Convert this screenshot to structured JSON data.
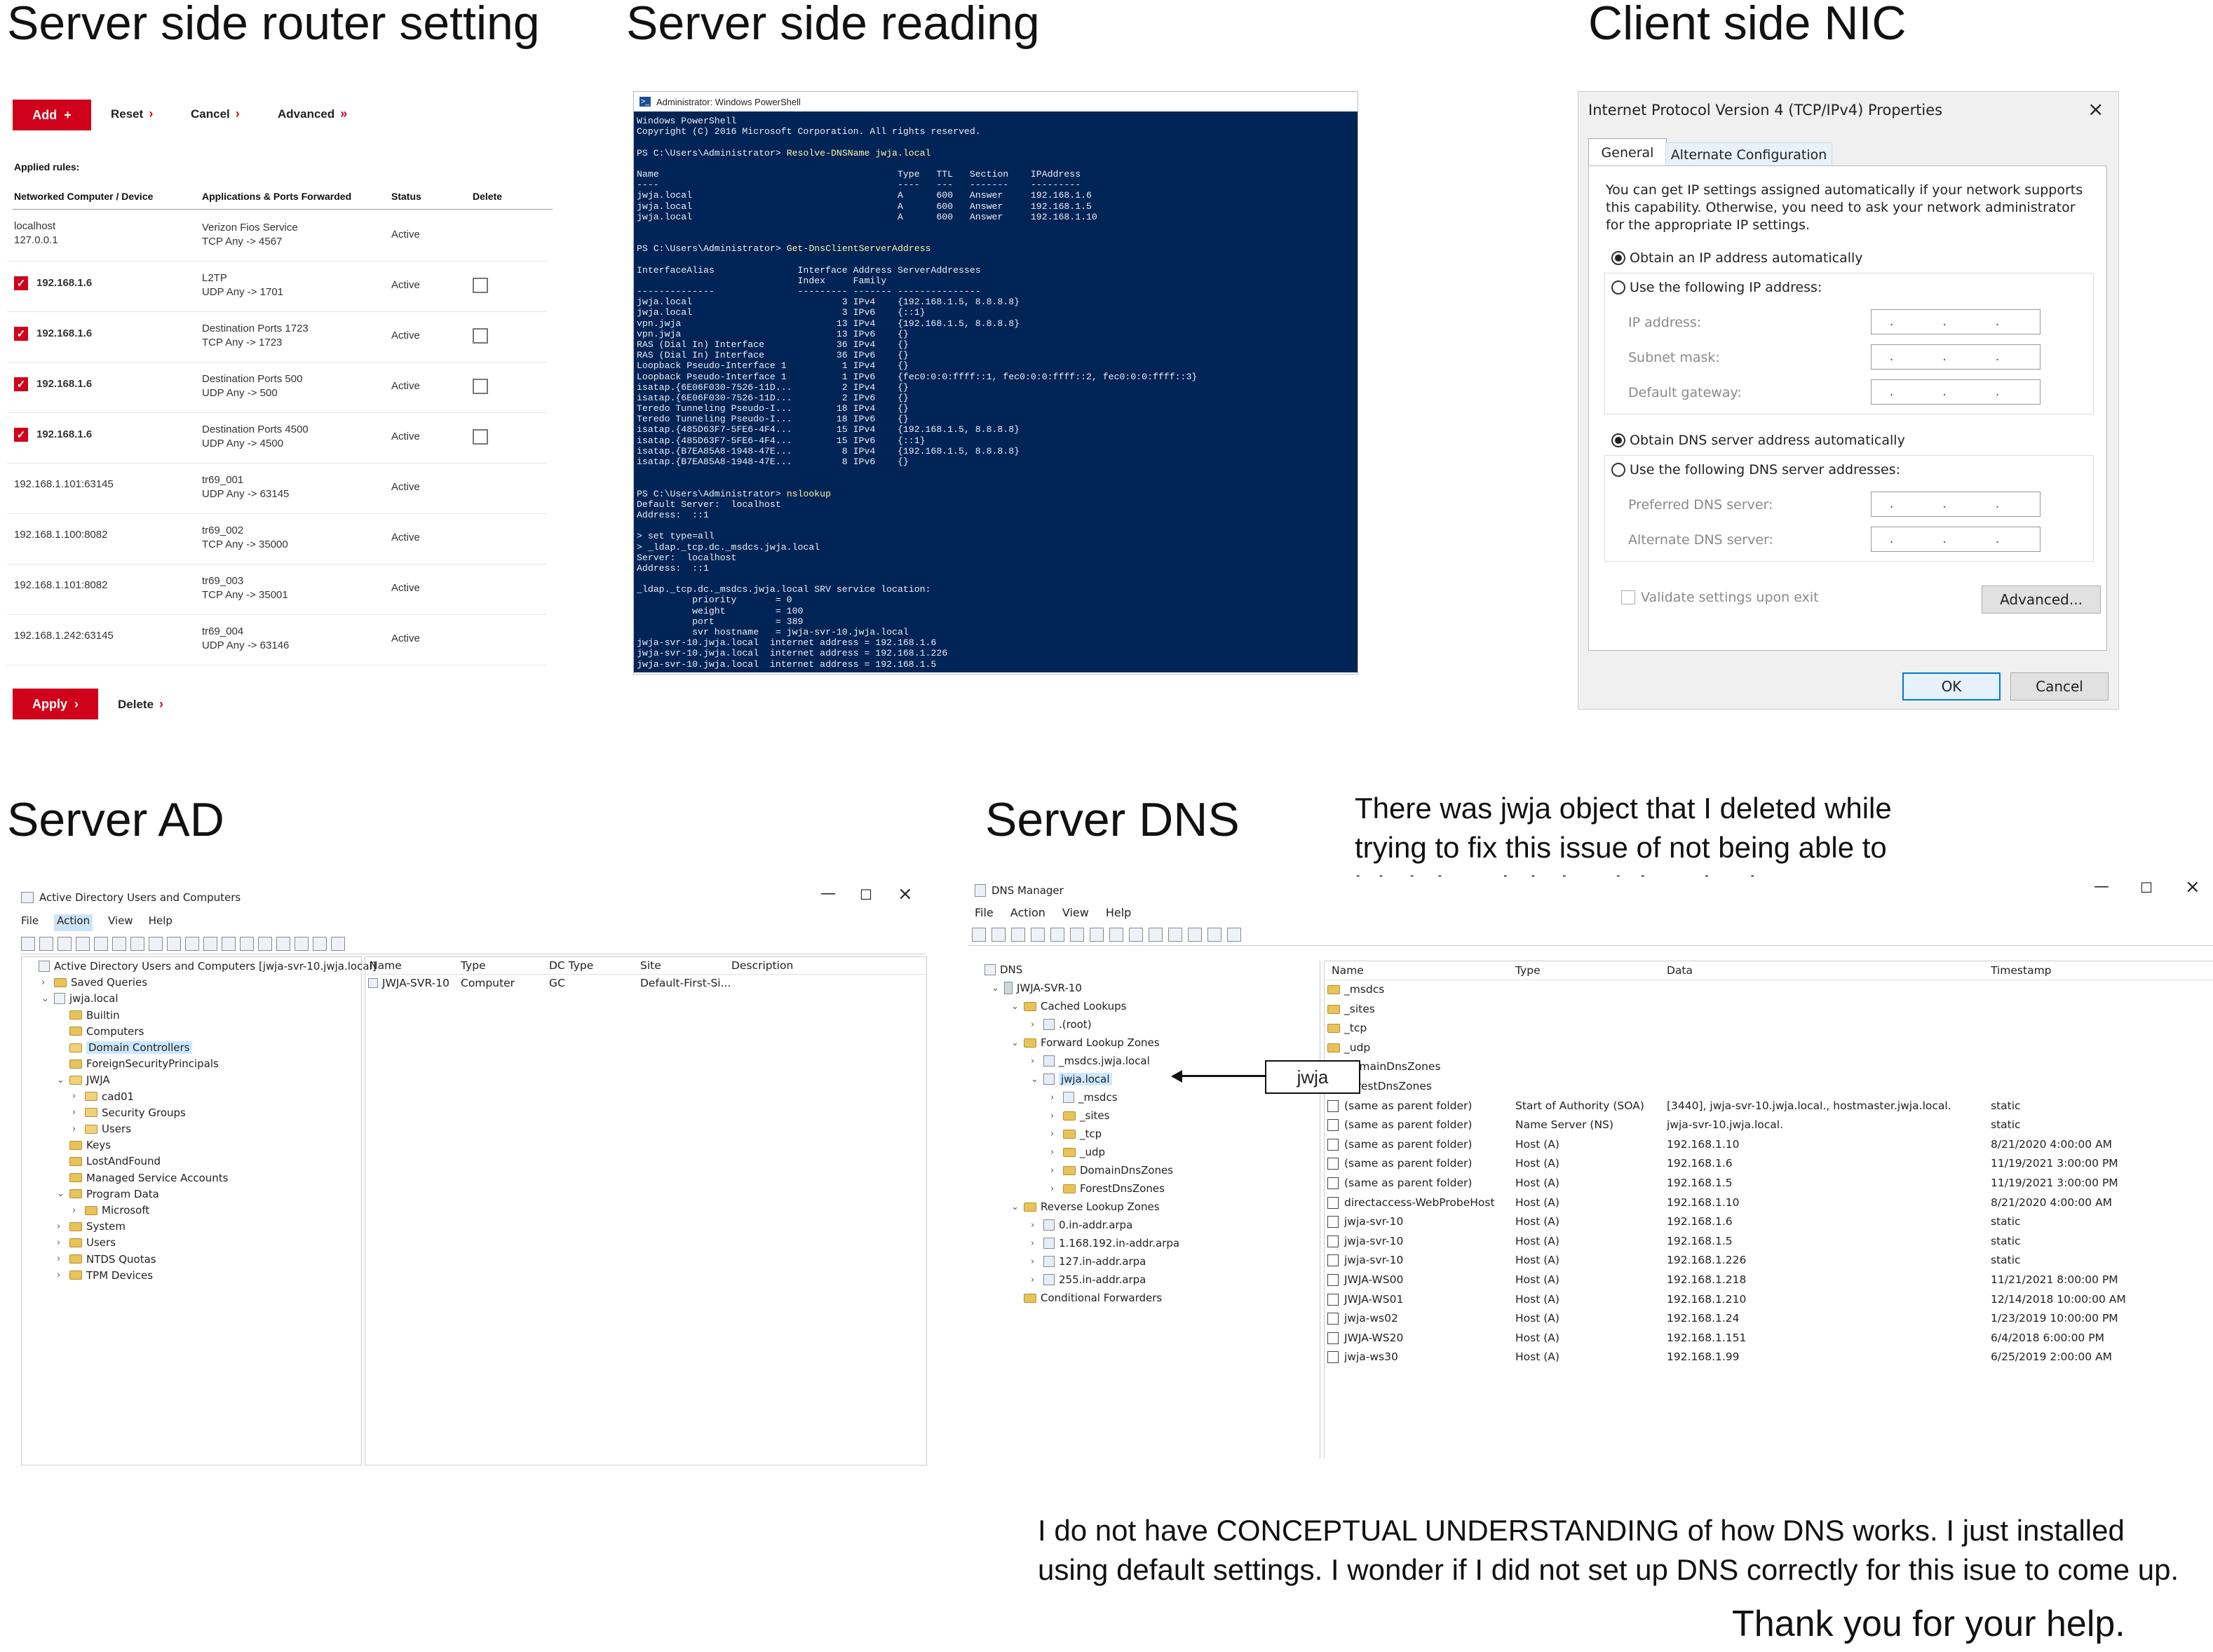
{
  "headings": {
    "router": "Server side router setting",
    "reading": "Server side reading",
    "nic": "Client side NIC",
    "ad": "Server AD",
    "dns": "Server DNS"
  },
  "notes": {
    "deleted": "There was jwja object that I deleted while trying to fix this issue of not being able to join jwja or jwja.local domain via VPN.",
    "conceptual": "I do not have CONCEPTUAL UNDERSTANDING of how DNS works. I just installed using default settings. I wonder if I did not set up DNS correctly for this isue to come up.",
    "thanks": "Thank you for your help."
  },
  "router": {
    "add_label": "Add",
    "reset_label": "Reset",
    "cancel_label": "Cancel",
    "advanced_label": "Advanced",
    "applied_rules": "Applied rules:",
    "columns": [
      "Networked Computer / Device",
      "Applications & Ports Forwarded",
      "Status",
      "Delete"
    ],
    "rows": [
      {
        "device": "localhost",
        "device2": "127.0.0.1",
        "app": "Verizon Fios Service",
        "ports": "TCP Any -> 4567",
        "status": "Active",
        "checked": false,
        "has_delete": false
      },
      {
        "device": "192.168.1.6",
        "device2": "",
        "app": "L2TP",
        "ports": "UDP Any -> 1701",
        "status": "Active",
        "checked": true,
        "has_delete": true
      },
      {
        "device": "192.168.1.6",
        "device2": "",
        "app": "Destination Ports 1723",
        "ports": "TCP Any -> 1723",
        "status": "Active",
        "checked": true,
        "has_delete": true
      },
      {
        "device": "192.168.1.6",
        "device2": "",
        "app": "Destination Ports 500",
        "ports": "UDP Any -> 500",
        "status": "Active",
        "checked": true,
        "has_delete": true
      },
      {
        "device": "192.168.1.6",
        "device2": "",
        "app": "Destination Ports 4500",
        "ports": "UDP Any -> 4500",
        "status": "Active",
        "checked": true,
        "has_delete": true
      },
      {
        "device": "192.168.1.101:63145",
        "device2": "",
        "app": "tr69_001",
        "ports": "UDP Any -> 63145",
        "status": "Active",
        "checked": false,
        "has_delete": false
      },
      {
        "device": "192.168.1.100:8082",
        "device2": "",
        "app": "tr69_002",
        "ports": "TCP Any -> 35000",
        "status": "Active",
        "checked": false,
        "has_delete": false
      },
      {
        "device": "192.168.1.101:8082",
        "device2": "",
        "app": "tr69_003",
        "ports": "TCP Any -> 35001",
        "status": "Active",
        "checked": false,
        "has_delete": false
      },
      {
        "device": "192.168.1.242:63145",
        "device2": "",
        "app": "tr69_004",
        "ports": "UDP Any -> 63146",
        "status": "Active",
        "checked": false,
        "has_delete": false
      }
    ],
    "apply_label": "Apply",
    "delete_label": "Delete"
  },
  "powershell": {
    "title": "Administrator: Windows PowerShell",
    "lines": [
      {
        "t": "Windows PowerShell",
        "c": ""
      },
      {
        "t": "Copyright (C) 2016 Microsoft Corporation. All rights reserved.",
        "c": ""
      },
      {
        "t": "",
        "c": ""
      },
      {
        "t": "PS C:\\Users\\Administrator> ",
        "c": "Resolve-DNSName jwja.local"
      },
      {
        "t": "",
        "c": ""
      },
      {
        "t": "Name                                           Type   TTL   Section    IPAddress",
        "c": ""
      },
      {
        "t": "----                                           ----   ---   -------    ---------",
        "c": ""
      },
      {
        "t": "jwja.local                                     A      600   Answer     192.168.1.6",
        "c": ""
      },
      {
        "t": "jwja.local                                     A      600   Answer     192.168.1.5",
        "c": ""
      },
      {
        "t": "jwja.local                                     A      600   Answer     192.168.1.10",
        "c": ""
      },
      {
        "t": "",
        "c": ""
      },
      {
        "t": "",
        "c": ""
      },
      {
        "t": "PS C:\\Users\\Administrator> ",
        "c": "Get-DnsClientServerAddress"
      },
      {
        "t": "",
        "c": ""
      },
      {
        "t": "InterfaceAlias               Interface Address ServerAddresses",
        "c": ""
      },
      {
        "t": "                             Index     Family",
        "c": ""
      },
      {
        "t": "--------------               --------- ------- ---------------",
        "c": ""
      },
      {
        "t": "jwja.local                           3 IPv4    {192.168.1.5, 8.8.8.8}",
        "c": ""
      },
      {
        "t": "jwja.local                           3 IPv6    {::1}",
        "c": ""
      },
      {
        "t": "vpn.jwja                            13 IPv4    {192.168.1.5, 8.8.8.8}",
        "c": ""
      },
      {
        "t": "vpn.jwja                            13 IPv6    {}",
        "c": ""
      },
      {
        "t": "RAS (Dial In) Interface             36 IPv4    {}",
        "c": ""
      },
      {
        "t": "RAS (Dial In) Interface             36 IPv6    {}",
        "c": ""
      },
      {
        "t": "Loopback Pseudo-Interface 1          1 IPv4    {}",
        "c": ""
      },
      {
        "t": "Loopback Pseudo-Interface 1          1 IPv6    {fec0:0:0:ffff::1, fec0:0:0:ffff::2, fec0:0:0:ffff::3}",
        "c": ""
      },
      {
        "t": "isatap.{6E06F030-7526-11D...         2 IPv4    {}",
        "c": ""
      },
      {
        "t": "isatap.{6E06F030-7526-11D...         2 IPv6    {}",
        "c": ""
      },
      {
        "t": "Teredo Tunneling Pseudo-I...        18 IPv4    {}",
        "c": ""
      },
      {
        "t": "Teredo Tunneling Pseudo-I...        18 IPv6    {}",
        "c": ""
      },
      {
        "t": "isatap.{485D63F7-5FE6-4F4...        15 IPv4    {192.168.1.5, 8.8.8.8}",
        "c": ""
      },
      {
        "t": "isatap.{485D63F7-5FE6-4F4...        15 IPv6    {::1}",
        "c": ""
      },
      {
        "t": "isatap.{B7EA85A8-1948-47E...         8 IPv4    {192.168.1.5, 8.8.8.8}",
        "c": ""
      },
      {
        "t": "isatap.{B7EA85A8-1948-47E...         8 IPv6    {}",
        "c": ""
      },
      {
        "t": "",
        "c": ""
      },
      {
        "t": "",
        "c": ""
      },
      {
        "t": "PS C:\\Users\\Administrator> ",
        "c": "nslookup"
      },
      {
        "t": "Default Server:  localhost",
        "c": ""
      },
      {
        "t": "Address:  ::1",
        "c": ""
      },
      {
        "t": "",
        "c": ""
      },
      {
        "t": "> set type=all",
        "c": ""
      },
      {
        "t": "> _ldap._tcp.dc._msdcs.jwja.local",
        "c": ""
      },
      {
        "t": "Server:  localhost",
        "c": ""
      },
      {
        "t": "Address:  ::1",
        "c": ""
      },
      {
        "t": "",
        "c": ""
      },
      {
        "t": "_ldap._tcp.dc._msdcs.jwja.local SRV service location:",
        "c": ""
      },
      {
        "t": "          priority       = 0",
        "c": ""
      },
      {
        "t": "          weight         = 100",
        "c": ""
      },
      {
        "t": "          port           = 389",
        "c": ""
      },
      {
        "t": "          svr hostname   = jwja-svr-10.jwja.local",
        "c": ""
      },
      {
        "t": "jwja-svr-10.jwja.local  internet address = 192.168.1.6",
        "c": ""
      },
      {
        "t": "jwja-svr-10.jwja.local  internet address = 192.168.1.226",
        "c": ""
      },
      {
        "t": "jwja-svr-10.jwja.local  internet address = 192.168.1.5",
        "c": ""
      },
      {
        "t": "> _",
        "c": ""
      }
    ]
  },
  "nic": {
    "title": "Internet Protocol Version 4 (TCP/IPv4) Properties",
    "tabs": [
      "General",
      "Alternate Configuration"
    ],
    "description": "You can get IP settings assigned automatically if your network supports this capability. Otherwise, you need to ask your network administrator for the appropriate IP settings.",
    "obtain_ip": "Obtain an IP address automatically",
    "use_ip": "Use the following IP address:",
    "ip_label": "IP address:",
    "mask_label": "Subnet mask:",
    "gateway_label": "Default gateway:",
    "obtain_dns": "Obtain DNS server address automatically",
    "use_dns": "Use the following DNS server addresses:",
    "pref_dns": "Preferred DNS server:",
    "alt_dns": "Alternate DNS server:",
    "ip_placeholder": ". . .",
    "validate": "Validate settings upon exit",
    "advanced": "Advanced...",
    "ok": "OK",
    "cancel": "Cancel"
  },
  "ad": {
    "title": "Active Directory Users and Computers",
    "menu": [
      "File",
      "Action",
      "View",
      "Help"
    ],
    "tree": [
      {
        "label": "Active Directory Users and Computers [jwja-svr-10.jwja.local]",
        "indent": 0,
        "icon": "console",
        "arrow": ""
      },
      {
        "label": "Saved Queries",
        "indent": 1,
        "icon": "folder",
        "arrow": ">"
      },
      {
        "label": "jwja.local",
        "indent": 1,
        "icon": "domain",
        "arrow": "v"
      },
      {
        "label": "Builtin",
        "indent": 2,
        "icon": "folder",
        "arrow": ""
      },
      {
        "label": "Computers",
        "indent": 2,
        "icon": "folder",
        "arrow": ""
      },
      {
        "label": "Domain Controllers",
        "indent": 2,
        "icon": "ou",
        "arrow": "",
        "selected": true
      },
      {
        "label": "ForeignSecurityPrincipals",
        "indent": 2,
        "icon": "folder",
        "arrow": ""
      },
      {
        "label": "JWJA",
        "indent": 2,
        "icon": "ou",
        "arrow": "v"
      },
      {
        "label": "cad01",
        "indent": 3,
        "icon": "ou",
        "arrow": ">"
      },
      {
        "label": "Security Groups",
        "indent": 3,
        "icon": "ou",
        "arrow": ">"
      },
      {
        "label": "Users",
        "indent": 3,
        "icon": "ou",
        "arrow": ">"
      },
      {
        "label": "Keys",
        "indent": 2,
        "icon": "folder",
        "arrow": ""
      },
      {
        "label": "LostAndFound",
        "indent": 2,
        "icon": "folder",
        "arrow": ""
      },
      {
        "label": "Managed Service Accounts",
        "indent": 2,
        "icon": "folder",
        "arrow": ""
      },
      {
        "label": "Program Data",
        "indent": 2,
        "icon": "folder",
        "arrow": "v"
      },
      {
        "label": "Microsoft",
        "indent": 3,
        "icon": "folder",
        "arrow": ">"
      },
      {
        "label": "System",
        "indent": 2,
        "icon": "folder",
        "arrow": ">"
      },
      {
        "label": "Users",
        "indent": 2,
        "icon": "folder",
        "arrow": ">"
      },
      {
        "label": "NTDS Quotas",
        "indent": 2,
        "icon": "folder",
        "arrow": ">"
      },
      {
        "label": "TPM Devices",
        "indent": 2,
        "icon": "folder",
        "arrow": ">"
      }
    ],
    "columns": [
      "Name",
      "Type",
      "DC Type",
      "Site",
      "Description"
    ],
    "rows": [
      {
        "name": "JWJA-SVR-10",
        "type": "Computer",
        "dctype": "GC",
        "site": "Default-First-Si...",
        "desc": ""
      }
    ]
  },
  "dns": {
    "title": "DNS Manager",
    "menu": [
      "File",
      "Action",
      "View",
      "Help"
    ],
    "tree": [
      {
        "label": "DNS",
        "indent": 0,
        "icon": "dns",
        "arrow": ""
      },
      {
        "label": "JWJA-SVR-10",
        "indent": 1,
        "icon": "server",
        "arrow": "v"
      },
      {
        "label": "Cached Lookups",
        "indent": 2,
        "icon": "folder",
        "arrow": "v"
      },
      {
        "label": ".(root)",
        "indent": 3,
        "icon": "zone",
        "arrow": ">"
      },
      {
        "label": "Forward Lookup Zones",
        "indent": 2,
        "icon": "folder",
        "arrow": "v"
      },
      {
        "label": "_msdcs.jwja.local",
        "indent": 3,
        "icon": "zone",
        "arrow": ">"
      },
      {
        "label": "jwja.local",
        "indent": 3,
        "icon": "zone",
        "arrow": "v",
        "selected": true
      },
      {
        "label": "_msdcs",
        "indent": 4,
        "icon": "zone",
        "arrow": ">"
      },
      {
        "label": "_sites",
        "indent": 4,
        "icon": "folder",
        "arrow": ">"
      },
      {
        "label": "_tcp",
        "indent": 4,
        "icon": "folder",
        "arrow": ">"
      },
      {
        "label": "_udp",
        "indent": 4,
        "icon": "folder",
        "arrow": ">"
      },
      {
        "label": "DomainDnsZones",
        "indent": 4,
        "icon": "folder",
        "arrow": ">"
      },
      {
        "label": "ForestDnsZones",
        "indent": 4,
        "icon": "folder",
        "arrow": ">"
      },
      {
        "label": "Reverse Lookup Zones",
        "indent": 2,
        "icon": "folder",
        "arrow": "v"
      },
      {
        "label": "0.in-addr.arpa",
        "indent": 3,
        "icon": "zone",
        "arrow": ">"
      },
      {
        "label": "1.168.192.in-addr.arpa",
        "indent": 3,
        "icon": "zone",
        "arrow": ">"
      },
      {
        "label": "127.in-addr.arpa",
        "indent": 3,
        "icon": "zone",
        "arrow": ">"
      },
      {
        "label": "255.in-addr.arpa",
        "indent": 3,
        "icon": "zone",
        "arrow": ">"
      },
      {
        "label": "Conditional Forwarders",
        "indent": 2,
        "icon": "folder",
        "arrow": ""
      }
    ],
    "callout": "jwja",
    "columns": [
      "Name",
      "Type",
      "Data",
      "Timestamp"
    ],
    "rows": [
      {
        "name": "_msdcs",
        "type": "",
        "data": "",
        "ts": "",
        "icon": "folder"
      },
      {
        "name": "_sites",
        "type": "",
        "data": "",
        "ts": "",
        "icon": "folder"
      },
      {
        "name": "_tcp",
        "type": "",
        "data": "",
        "ts": "",
        "icon": "folder"
      },
      {
        "name": "_udp",
        "type": "",
        "data": "",
        "ts": "",
        "icon": "folder"
      },
      {
        "name": "DomainDnsZones",
        "type": "",
        "data": "",
        "ts": "",
        "icon": "folder"
      },
      {
        "name": "ForestDnsZones",
        "type": "",
        "data": "",
        "ts": "",
        "icon": "folder"
      },
      {
        "name": "(same as parent folder)",
        "type": "Start of Authority (SOA)",
        "data": "[3440], jwja-svr-10.jwja.local., hostmaster.jwja.local.",
        "ts": "static",
        "icon": "record"
      },
      {
        "name": "(same as parent folder)",
        "type": "Name Server (NS)",
        "data": "jwja-svr-10.jwja.local.",
        "ts": "static",
        "icon": "record"
      },
      {
        "name": "(same as parent folder)",
        "type": "Host (A)",
        "data": "192.168.1.10",
        "ts": "8/21/2020 4:00:00 AM",
        "icon": "record"
      },
      {
        "name": "(same as parent folder)",
        "type": "Host (A)",
        "data": "192.168.1.6",
        "ts": "11/19/2021 3:00:00 PM",
        "icon": "record"
      },
      {
        "name": "(same as parent folder)",
        "type": "Host (A)",
        "data": "192.168.1.5",
        "ts": "11/19/2021 3:00:00 PM",
        "icon": "record"
      },
      {
        "name": "directaccess-WebProbeHost",
        "type": "Host (A)",
        "data": "192.168.1.10",
        "ts": "8/21/2020 4:00:00 AM",
        "icon": "record"
      },
      {
        "name": "jwja-svr-10",
        "type": "Host (A)",
        "data": "192.168.1.6",
        "ts": "static",
        "icon": "record"
      },
      {
        "name": "jwja-svr-10",
        "type": "Host (A)",
        "data": "192.168.1.5",
        "ts": "static",
        "icon": "record"
      },
      {
        "name": "jwja-svr-10",
        "type": "Host (A)",
        "data": "192.168.1.226",
        "ts": "static",
        "icon": "record"
      },
      {
        "name": "JWJA-WS00",
        "type": "Host (A)",
        "data": "192.168.1.218",
        "ts": "11/21/2021 8:00:00 PM",
        "icon": "record"
      },
      {
        "name": "JWJA-WS01",
        "type": "Host (A)",
        "data": "192.168.1.210",
        "ts": "12/14/2018 10:00:00 AM",
        "icon": "record"
      },
      {
        "name": "jwja-ws02",
        "type": "Host (A)",
        "data": "192.168.1.24",
        "ts": "1/23/2019 10:00:00 PM",
        "icon": "record"
      },
      {
        "name": "JWJA-WS20",
        "type": "Host (A)",
        "data": "192.168.1.151",
        "ts": "6/4/2018 6:00:00 PM",
        "icon": "record"
      },
      {
        "name": "jwja-ws30",
        "type": "Host (A)",
        "data": "192.168.1.99",
        "ts": "6/25/2019 2:00:00 AM",
        "icon": "record"
      }
    ]
  }
}
